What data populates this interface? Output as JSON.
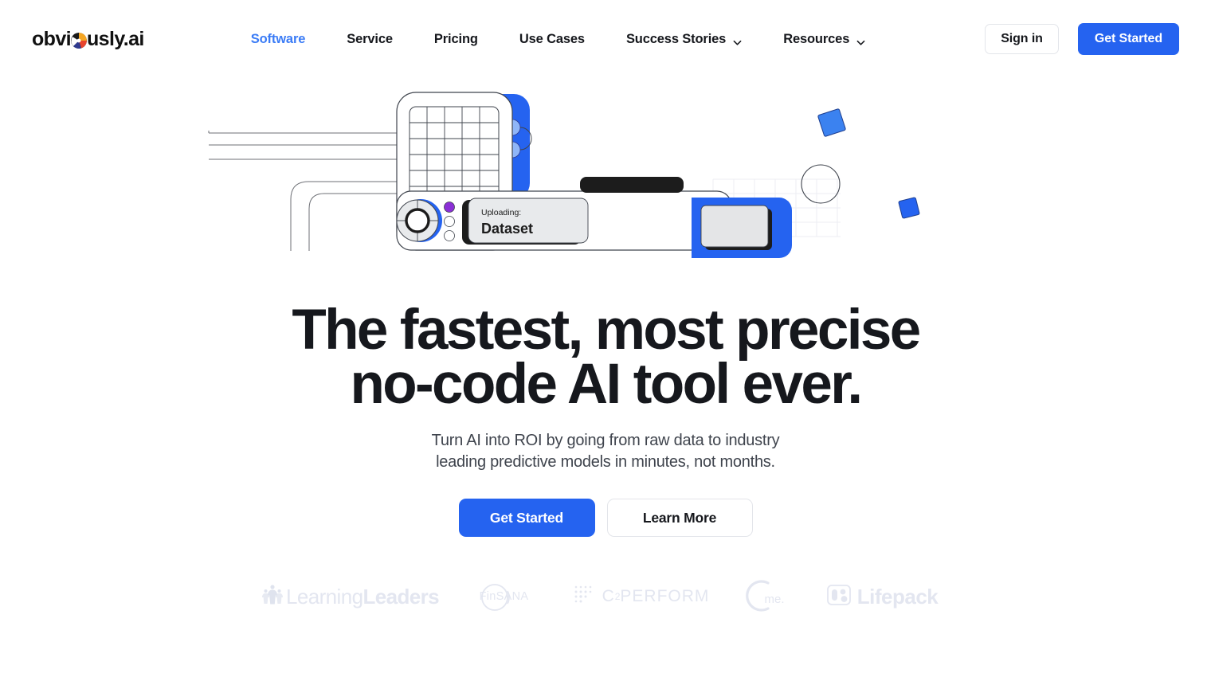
{
  "brand": {
    "name_pre": "obvi",
    "name_mark": "pie-chart-o",
    "name_post": "usly.ai",
    "accent": "#2563f0",
    "active_nav_color": "#3b7cf6"
  },
  "nav": {
    "items": [
      {
        "label": "Software",
        "active": true,
        "dropdown": false
      },
      {
        "label": "Service",
        "active": false,
        "dropdown": false
      },
      {
        "label": "Pricing",
        "active": false,
        "dropdown": false
      },
      {
        "label": "Use Cases",
        "active": false,
        "dropdown": false
      },
      {
        "label": "Success Stories",
        "active": false,
        "dropdown": true
      },
      {
        "label": "Resources",
        "active": false,
        "dropdown": true
      }
    ],
    "sign_in_label": "Sign in",
    "get_started_label": "Get Started"
  },
  "hero": {
    "headline_line1": "The fastest, most precise",
    "headline_line2": "no-code AI tool ever.",
    "subhead_line1": "Turn AI into ROI by going from raw data to industry",
    "subhead_line2": "leading predictive models in minutes, not months.",
    "primary_cta": "Get Started",
    "secondary_cta": "Learn More"
  },
  "illustration": {
    "screen_label": "Uploading:",
    "screen_value": "Dataset",
    "grid_columns": 5,
    "grid_rows": 8,
    "accent": "#2563f0",
    "dot_active_color": "#8b2fd6"
  },
  "client_logos": [
    {
      "name": "LearningLeaders",
      "text_light": "Learning",
      "text_bold": "Leaders"
    },
    {
      "name": "FinSANA",
      "text_light": "FinS",
      "text_bold": "ANA"
    },
    {
      "name": "C2PERFORM",
      "text_light": "C",
      "text_bold": "PERFORM",
      "superscript": "2"
    },
    {
      "name": "Cme",
      "text_light": "",
      "text_bold": "me."
    },
    {
      "name": "Lifepack",
      "text_light": "",
      "text_bold": "Lifepack"
    }
  ]
}
